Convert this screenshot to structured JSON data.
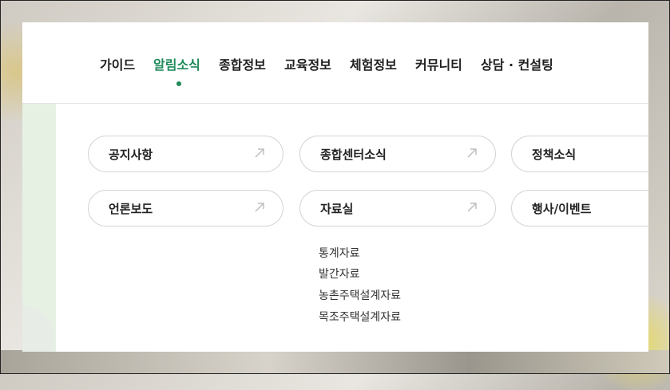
{
  "gnb": {
    "items": [
      {
        "label": "가이드"
      },
      {
        "label": "알림소식"
      },
      {
        "label": "종합정보"
      },
      {
        "label": "교육정보"
      },
      {
        "label": "체험정보"
      },
      {
        "label": "커뮤니티"
      },
      {
        "label": "상담 · 컨설팅"
      }
    ],
    "active_index": 1
  },
  "submenu": {
    "cards": [
      {
        "label": "공지사항"
      },
      {
        "label": "종합센터소식"
      },
      {
        "label": "정책소식"
      },
      {
        "label": "언론보도"
      },
      {
        "label": "자료실"
      },
      {
        "label": "행사/이벤트"
      }
    ],
    "archive_children": [
      {
        "label": "통계자료"
      },
      {
        "label": "발간자료"
      },
      {
        "label": "농촌주택설계자료"
      },
      {
        "label": "목조주택설계자료"
      }
    ]
  },
  "colors": {
    "accent": "#1e8a5a",
    "side_strip": "#e6f1e4"
  },
  "icons": {
    "card_arrow": "diagonal-arrow-icon"
  }
}
